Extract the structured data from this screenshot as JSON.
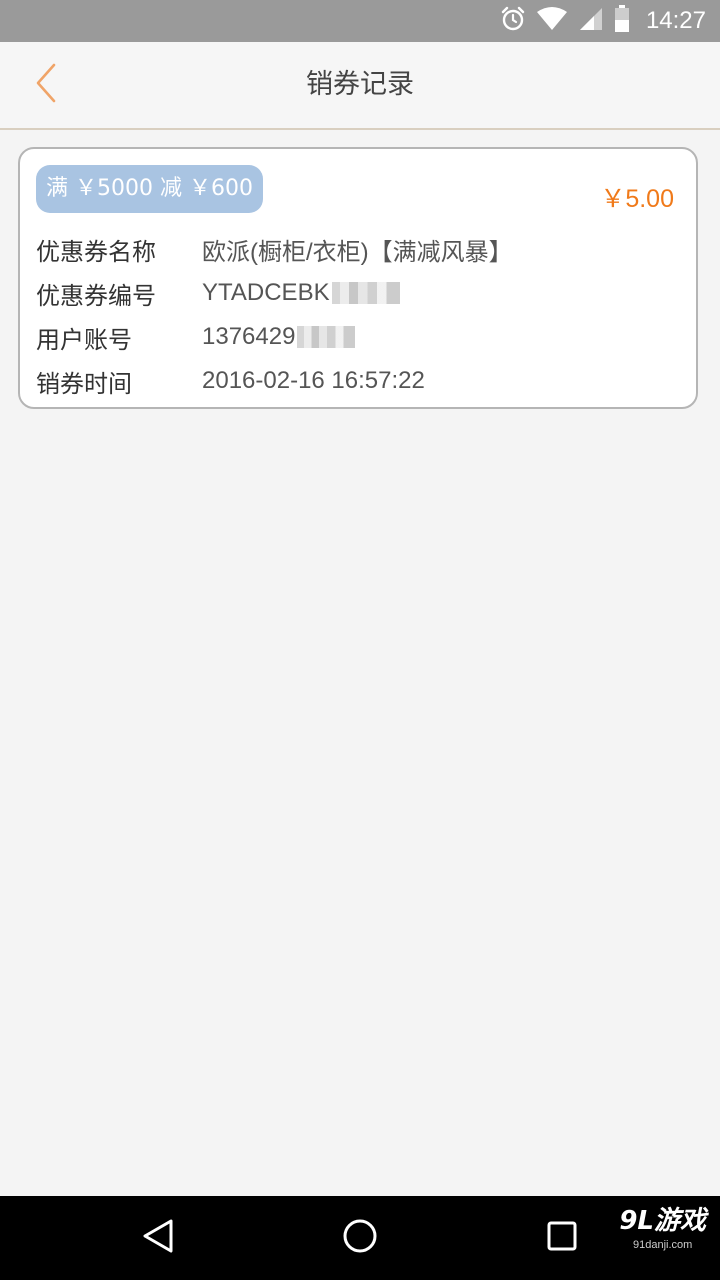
{
  "status_bar": {
    "time": "14:27",
    "icons": [
      "alarm-icon",
      "wifi-icon",
      "signal-icon",
      "battery-icon"
    ]
  },
  "header": {
    "back_icon": "chevron-left-icon",
    "title": "销券记录"
  },
  "coupon": {
    "badge": "满 ￥5000 减 ￥600",
    "amount": "￥5.00",
    "rows": [
      {
        "label": "优惠券名称",
        "value": "欧派(橱柜/衣柜)【满减风暴】"
      },
      {
        "label": "优惠券编号",
        "value": "YTADCEBK"
      },
      {
        "label": "用户账号",
        "value": "1376429"
      },
      {
        "label": "销券时间",
        "value": "2016-02-16 16:57:22"
      }
    ]
  },
  "nav_bar": {
    "icons": [
      "nav-back-icon",
      "nav-home-icon",
      "nav-recents-icon"
    ]
  },
  "watermark": {
    "brand": "9L游戏",
    "site": "91danji.com"
  },
  "colors": {
    "accent_orange": "#f07a1a",
    "badge_blue": "#a9c4e2",
    "status_bar": "#9a9a9a",
    "background": "#f4f4f4"
  }
}
